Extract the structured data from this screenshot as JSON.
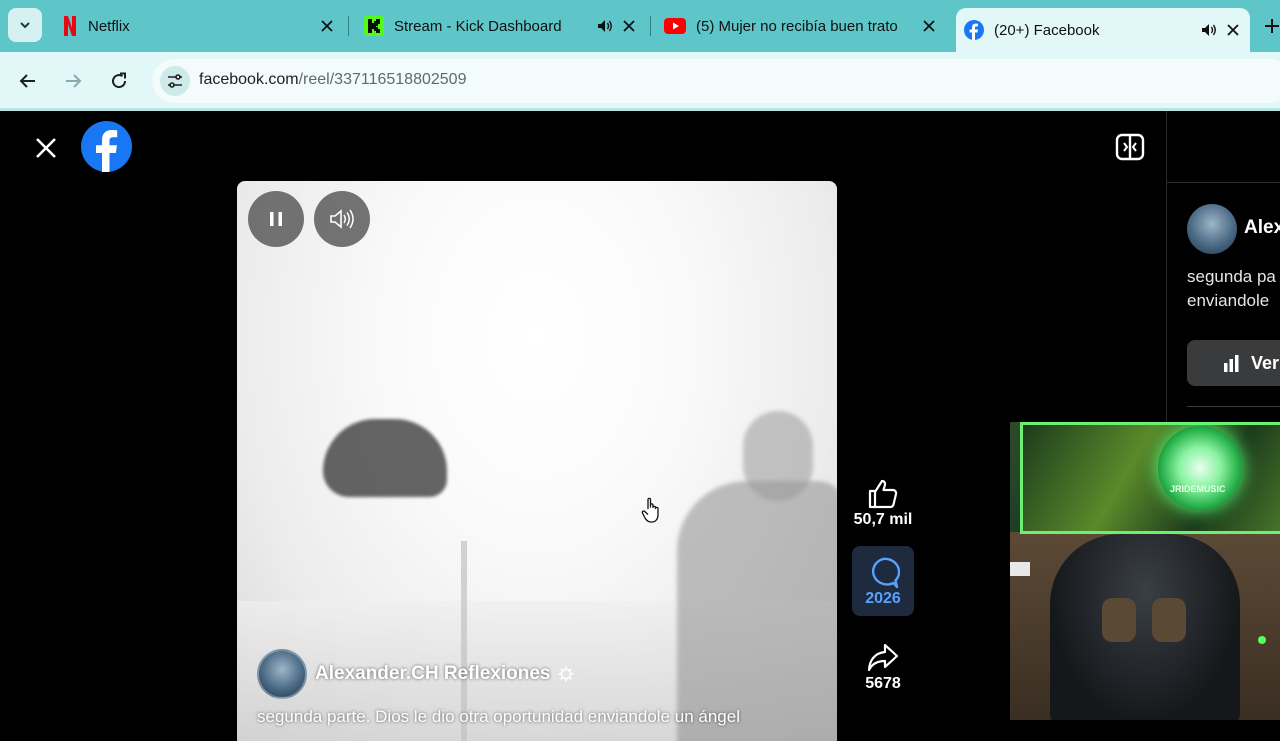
{
  "browser": {
    "tabs": [
      {
        "title": "Netflix",
        "favicon": "netflix-icon",
        "audio": false,
        "active": false
      },
      {
        "title": "Stream - Kick Dashboard",
        "favicon": "kick-icon",
        "audio": true,
        "active": false
      },
      {
        "title": "(5) Mujer no recibía buen trato",
        "favicon": "youtube-icon",
        "audio": false,
        "active": false
      },
      {
        "title": "(20+) Facebook",
        "favicon": "facebook-icon",
        "audio": true,
        "active": true
      }
    ],
    "url_host": "facebook.com",
    "url_path": "/reel/337116518802509",
    "accent_color": "#5ec6c9"
  },
  "reel": {
    "author_name": "Alexander.CH Reflexiones",
    "caption": "segunda parte. Dios le dio otra oportunidad enviandole un ángel",
    "likes": "50,7 mil",
    "comments": "2026",
    "shares": "5678"
  },
  "side_panel": {
    "author_name": "Alex",
    "caption_line1": "segunda pa",
    "caption_line2": "enviandole",
    "insights_button": "Ver"
  },
  "webcam": {
    "logo_text": "JRIDEMUSIC"
  }
}
